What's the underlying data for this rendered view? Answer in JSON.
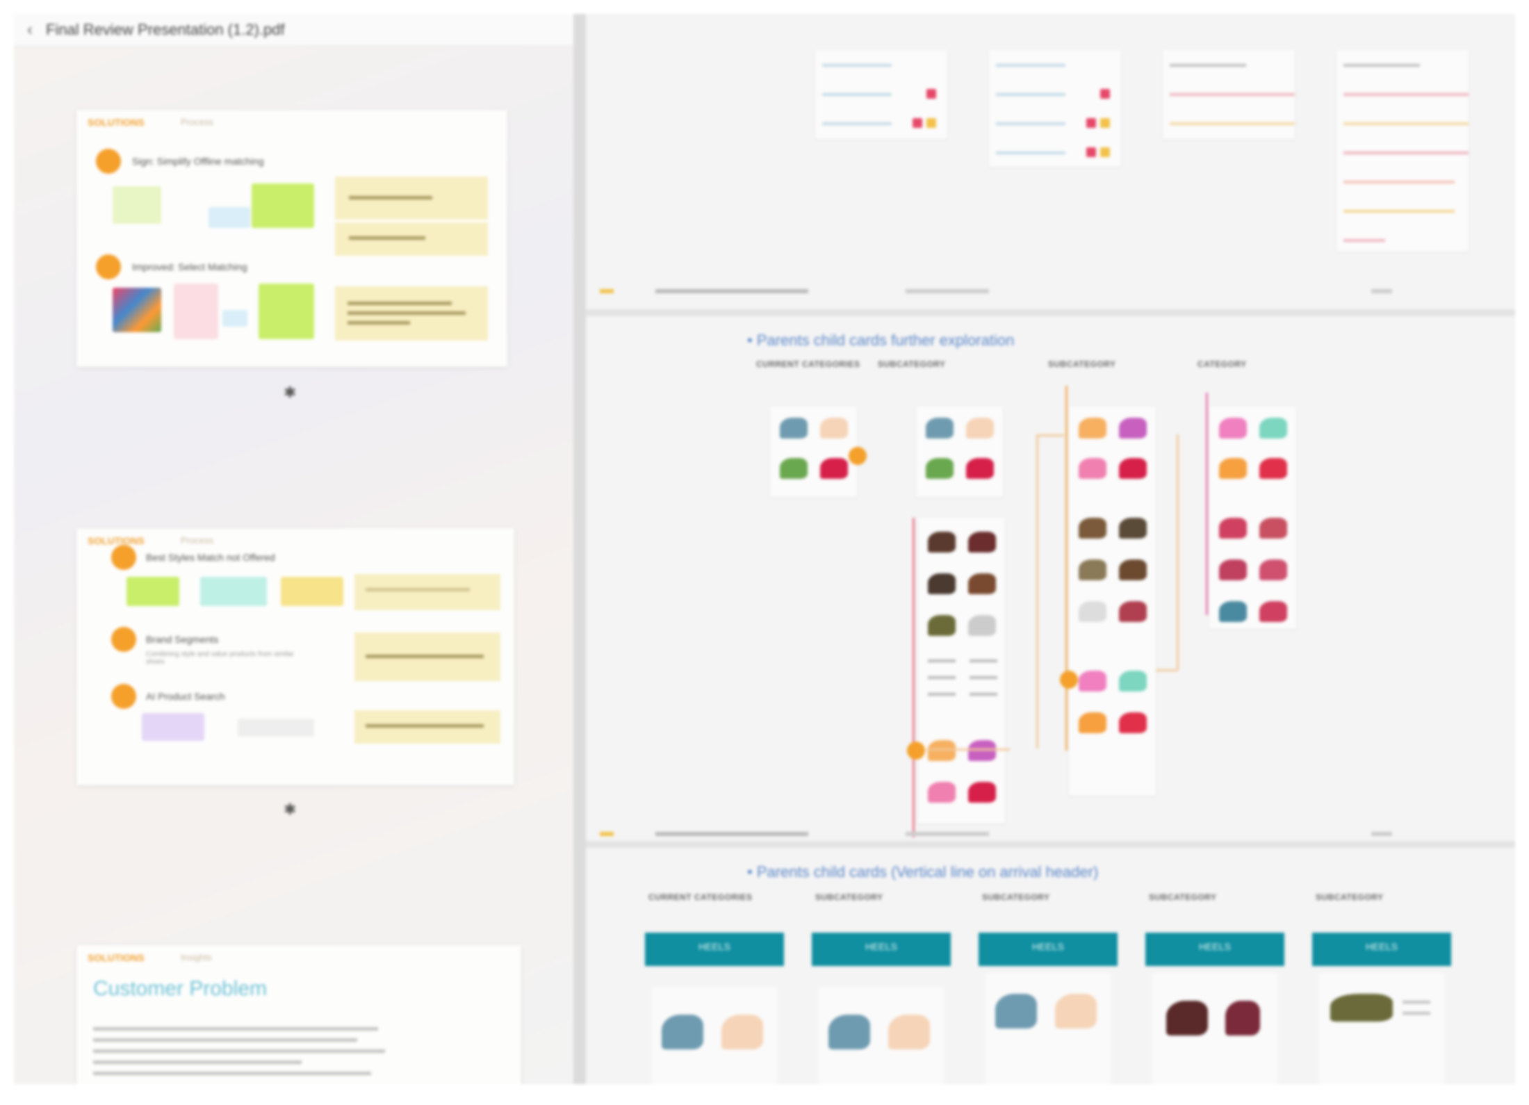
{
  "header": {
    "back_icon": "chevron-left-icon",
    "title": "Final Review Presentation (1.2).pdf"
  },
  "left_panel": {
    "slide1": {
      "label": "SOLUTIONS",
      "sublabel": "Process",
      "step1_text": "Sign: Simplify Offline matching",
      "step2_text": "Improved: Select Matching"
    },
    "slide2": {
      "label": "SOLUTIONS",
      "sublabel": "Process",
      "step1_text": "Best Styles Match not Offered",
      "step2_text": "Brand Segments",
      "step2_sub": "Combining style and value products from similar shoes",
      "step3_text": "AI Product Search"
    },
    "slide3": {
      "label": "SOLUTIONS",
      "sublabel": "Insights",
      "title": "Customer Problem"
    }
  },
  "right_panel": {
    "section2_title": "• Parents child cards further exploration",
    "section2_columns": [
      "CURRENT CATEGORIES",
      "SUBCATEGORY",
      "SUBCATEGORY",
      "CATEGORY"
    ],
    "section3_title": "• Parents child cards (Vertical line on arrival header)",
    "section3_columns": [
      "CURRENT CATEGORIES",
      "SUBCATEGORY",
      "SUBCATEGORY",
      "SUBCATEGORY",
      "SUBCATEGORY"
    ],
    "teal_labels": [
      "HEELS",
      "HEELS",
      "HEELS",
      "HEELS",
      "HEELS"
    ]
  },
  "colors": {
    "accent_orange": "#f4a02b",
    "teal": "#0f8fa0",
    "note_yellow": "#f7eec2"
  }
}
